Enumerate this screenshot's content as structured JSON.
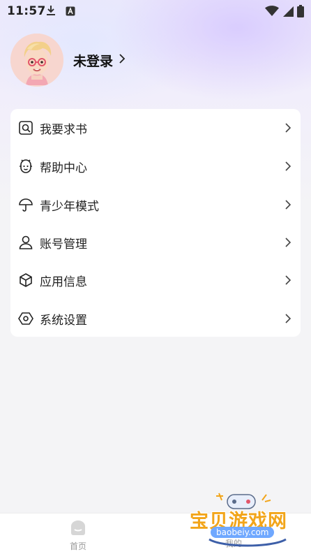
{
  "status_bar": {
    "time": "11:57",
    "icons": [
      "download-icon",
      "a-box-icon",
      "wifi-icon",
      "signal-icon",
      "battery-icon"
    ]
  },
  "profile": {
    "login_label": "未登录"
  },
  "menu": {
    "items": [
      {
        "label": "我要求书",
        "icon": "book-search-icon"
      },
      {
        "label": "帮助中心",
        "icon": "help-robot-icon"
      },
      {
        "label": "青少年模式",
        "icon": "umbrella-icon"
      },
      {
        "label": "账号管理",
        "icon": "user-icon"
      },
      {
        "label": "应用信息",
        "icon": "cube-icon"
      },
      {
        "label": "系统设置",
        "icon": "settings-hex-icon"
      }
    ]
  },
  "tabbar": {
    "home_label": "首页",
    "mine_label": "我的"
  },
  "watermark": {
    "title": "宝贝游戏网",
    "url": "baobeiy.com"
  },
  "colors": {
    "text": "#222222",
    "arrow": "#555555",
    "tab_inactive": "#9a9a9a",
    "watermark_orange": "#f2a51a",
    "watermark_blue": "#6fa8ff"
  }
}
